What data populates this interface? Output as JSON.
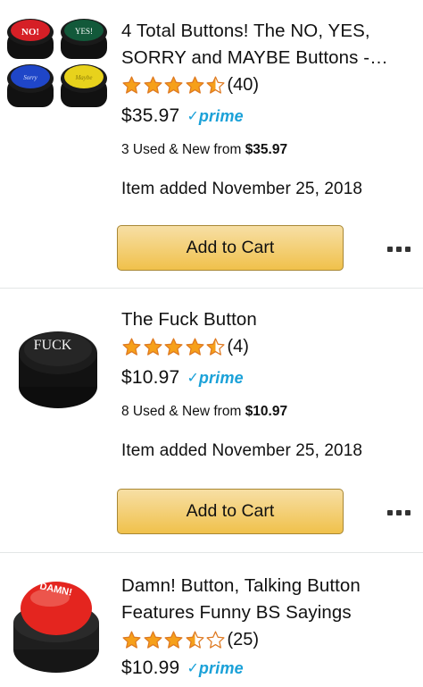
{
  "products": [
    {
      "title": "4 Total Buttons! The NO, YES, SORRY and MAYBE Buttons -…",
      "rating_count": "(40)",
      "price": "$35.97",
      "prime": "prime",
      "offers_prefix": "3 Used & New  from ",
      "offers_price": "$35.97",
      "added": "Item added November 25, 2018",
      "cart_label": "Add to Cart",
      "stars": [
        1,
        1,
        1,
        1,
        0.5
      ],
      "image_labels": [
        "NO!",
        "YES!",
        "Sorry",
        "Maybe"
      ]
    },
    {
      "title": "The Fuck Button",
      "rating_count": "(4)",
      "price": "$10.97",
      "prime": "prime",
      "offers_prefix": "8 Used & New  from ",
      "offers_price": "$10.97",
      "added": "Item added November 25, 2018",
      "cart_label": "Add to Cart",
      "stars": [
        1,
        1,
        1,
        1,
        0.5
      ],
      "image_labels": [
        "FUCK"
      ]
    },
    {
      "title": "Damn! Button, Talking Button Features Funny BS Sayings",
      "rating_count": "(25)",
      "price": "$10.99",
      "prime": "prime",
      "stars": [
        1,
        1,
        1,
        0.5,
        0
      ],
      "image_labels": [
        "DAMN!"
      ]
    }
  ],
  "colors": {
    "star_gold": "#f6a01a",
    "prime_blue": "#1aa1d8",
    "button_top": "#f7dfa5",
    "button_bottom": "#f0c14b"
  }
}
